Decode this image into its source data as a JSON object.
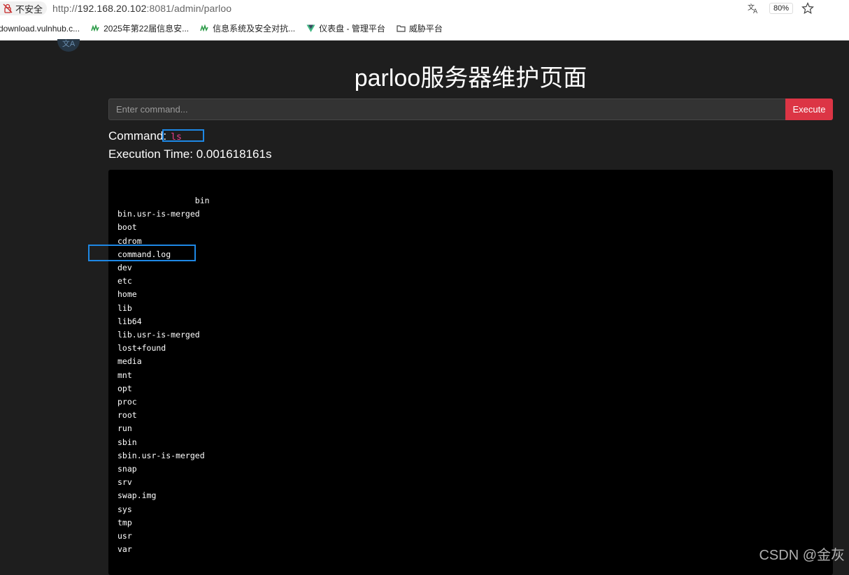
{
  "browser": {
    "security_label": "不安全",
    "url_scheme": "http://",
    "url_host": "192.168.20.102",
    "url_path": ":8081/admin/parloo",
    "zoom": "80%",
    "bookmarks": [
      {
        "label": "download.vulnhub.c...",
        "icon": "globe-icon"
      },
      {
        "label": "2025年第22届信息安...",
        "icon": "site-icon"
      },
      {
        "label": "信息系统及安全对抗...",
        "icon": "site-icon"
      },
      {
        "label": "仪表盘 - 管理平台",
        "icon": "vue-icon"
      },
      {
        "label": "威胁平台",
        "icon": "folder-icon"
      }
    ]
  },
  "page": {
    "title": "parloo服务器维护页面",
    "command_placeholder": "Enter command...",
    "execute_label": "Execute",
    "command_label": "Command:",
    "command_value": "ls",
    "time_label": "Execution Time:",
    "time_value": "0.001618161s",
    "output": "                bin\nbin.usr-is-merged\nboot\ncdrom\ncommand.log\ndev\netc\nhome\nlib\nlib64\nlib.usr-is-merged\nlost+found\nmedia\nmnt\nopt\nproc\nroot\nrun\nsbin\nsbin.usr-is-merged\nsnap\nsrv\nswap.img\nsys\ntmp\nusr\nvar"
  },
  "watermark": "CSDN @金灰",
  "colors": {
    "background": "#1e1e1e",
    "execute_button": "#dc3545",
    "command_value": "#e83e8c",
    "highlight": "#1e88e5"
  }
}
